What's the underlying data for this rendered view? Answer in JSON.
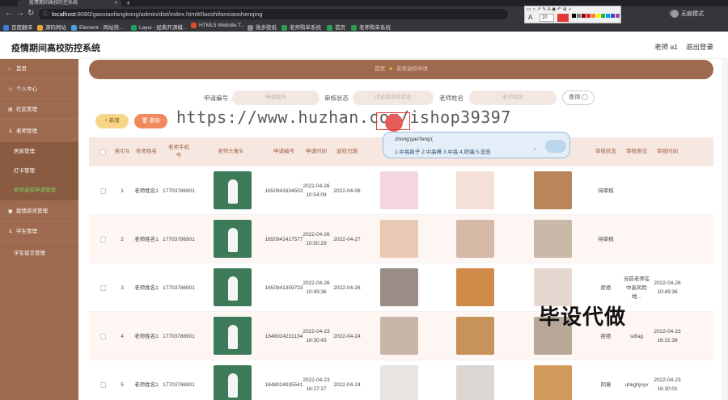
{
  "browser": {
    "tab_title": "疫情期间高校防控系统",
    "url_host": "localhost",
    "url_rest": ":8080/gaoxiaofangkong/admin/dist/index.html#/laoshifanxiaoshenqing",
    "profile": "无痕模式",
    "bookmarks": [
      "百度翻译",
      "源码网站",
      "Element - 网站快...",
      "Layui - 经典开源模...",
      "HTML5 Website T...",
      "微多壁纸",
      "老师购单系统",
      "首页",
      "老师购单系统"
    ]
  },
  "draw_toolbar": {
    "size": "20",
    "current_color": "#e53935",
    "swatches": [
      "#000000",
      "#7f7f7f",
      "#880015",
      "#ed1c24",
      "#ff7f27",
      "#fff200",
      "#22b14c",
      "#00a2e8",
      "#3f48cc",
      "#a349a4",
      "#ffffff",
      "#c3c3c3"
    ]
  },
  "app": {
    "title": "疫情期间高校防控系统",
    "user": "老师 a1",
    "logout": "退出登录"
  },
  "sidebar": {
    "items": [
      {
        "label": "首页",
        "icon": "home-icon"
      },
      {
        "label": "个人中心",
        "icon": "user-icon"
      },
      {
        "label": "社区管理",
        "icon": "folder-icon"
      },
      {
        "label": "老师管理",
        "icon": "person-icon"
      }
    ],
    "sub": [
      "居家管理",
      "打卡管理",
      "老师返校申请管理"
    ],
    "items2": [
      {
        "label": "疫情资讯管理",
        "icon": "news-icon"
      },
      {
        "label": "学生管理",
        "icon": "student-icon"
      },
      {
        "label": "学生留言管理",
        "icon": "message-icon"
      }
    ]
  },
  "breadcrumb": {
    "home": "首页",
    "page": "老师返校申请"
  },
  "search": {
    "f1_label": "申请编号",
    "f1_placeholder": "申请编号",
    "f2_label": "审核状态",
    "f2_placeholder": "请选择审核状态",
    "f3_label": "老师姓名",
    "f3_placeholder": "老师姓名",
    "button": "查询"
  },
  "actions": {
    "add": "新增",
    "delete": "删除"
  },
  "watermark": "https://www.huzhan.com/ishop39397",
  "ime": {
    "pinyin": "zhong'gao'feng'(",
    "candidates": "1.中高疯子 2.中高峰 3.中高 4.终端 5.忠告"
  },
  "stamp": "毕设代做",
  "table": {
    "headers": [
      "索引",
      "老师姓名",
      "老师手机号",
      "老师头像",
      "申请编号",
      "申请时间",
      "返校日期",
      "",
      "",
      "",
      "审核状态",
      "审核意见",
      "审核时间"
    ],
    "rows": [
      {
        "index": "1",
        "name": "老师姓名1",
        "phone": "17703786901",
        "apply_no": "1650941634553",
        "apply_time": "2022-04-26 10:54:09",
        "return_date": "2022-04-08",
        "status": "待审核",
        "opinion": "",
        "review_time": ""
      },
      {
        "index": "2",
        "name": "老师姓名1",
        "phone": "17703786901",
        "apply_no": "1650941417577",
        "apply_time": "2022-04-26 10:50:29",
        "return_date": "2022-04-27",
        "status": "待审核",
        "opinion": "",
        "review_time": ""
      },
      {
        "index": "3",
        "name": "老师姓名1",
        "phone": "17703786901",
        "apply_no": "1650941359703",
        "apply_time": "2022-04-26 10:49:36",
        "return_date": "2022-04-26",
        "status": "拒绝",
        "opinion": "当前老师在中高风险地...",
        "review_time": "2022-04-26 10:49:36"
      },
      {
        "index": "4",
        "name": "老师姓名1",
        "phone": "17703786901",
        "apply_no": "1648024231134",
        "apply_time": "2022-04-23 16:30:43",
        "return_date": "2022-04-24",
        "status": "拒绝",
        "opinion": "sdfag",
        "review_time": "2022-04-23 16:31:38"
      },
      {
        "index": "5",
        "name": "老师姓名1",
        "phone": "17703786901",
        "apply_no": "1648024035541",
        "apply_time": "2022-04-23 16:27:27",
        "return_date": "2022-04-24",
        "status": "同意",
        "opinion": "uhkghjvyv",
        "review_time": "2022-04-23 16:30:01"
      }
    ]
  },
  "colors": {
    "sidebar": "#9d6a4f",
    "accent_green": "#7bd35a",
    "header_bg": "#f6e8e1"
  }
}
